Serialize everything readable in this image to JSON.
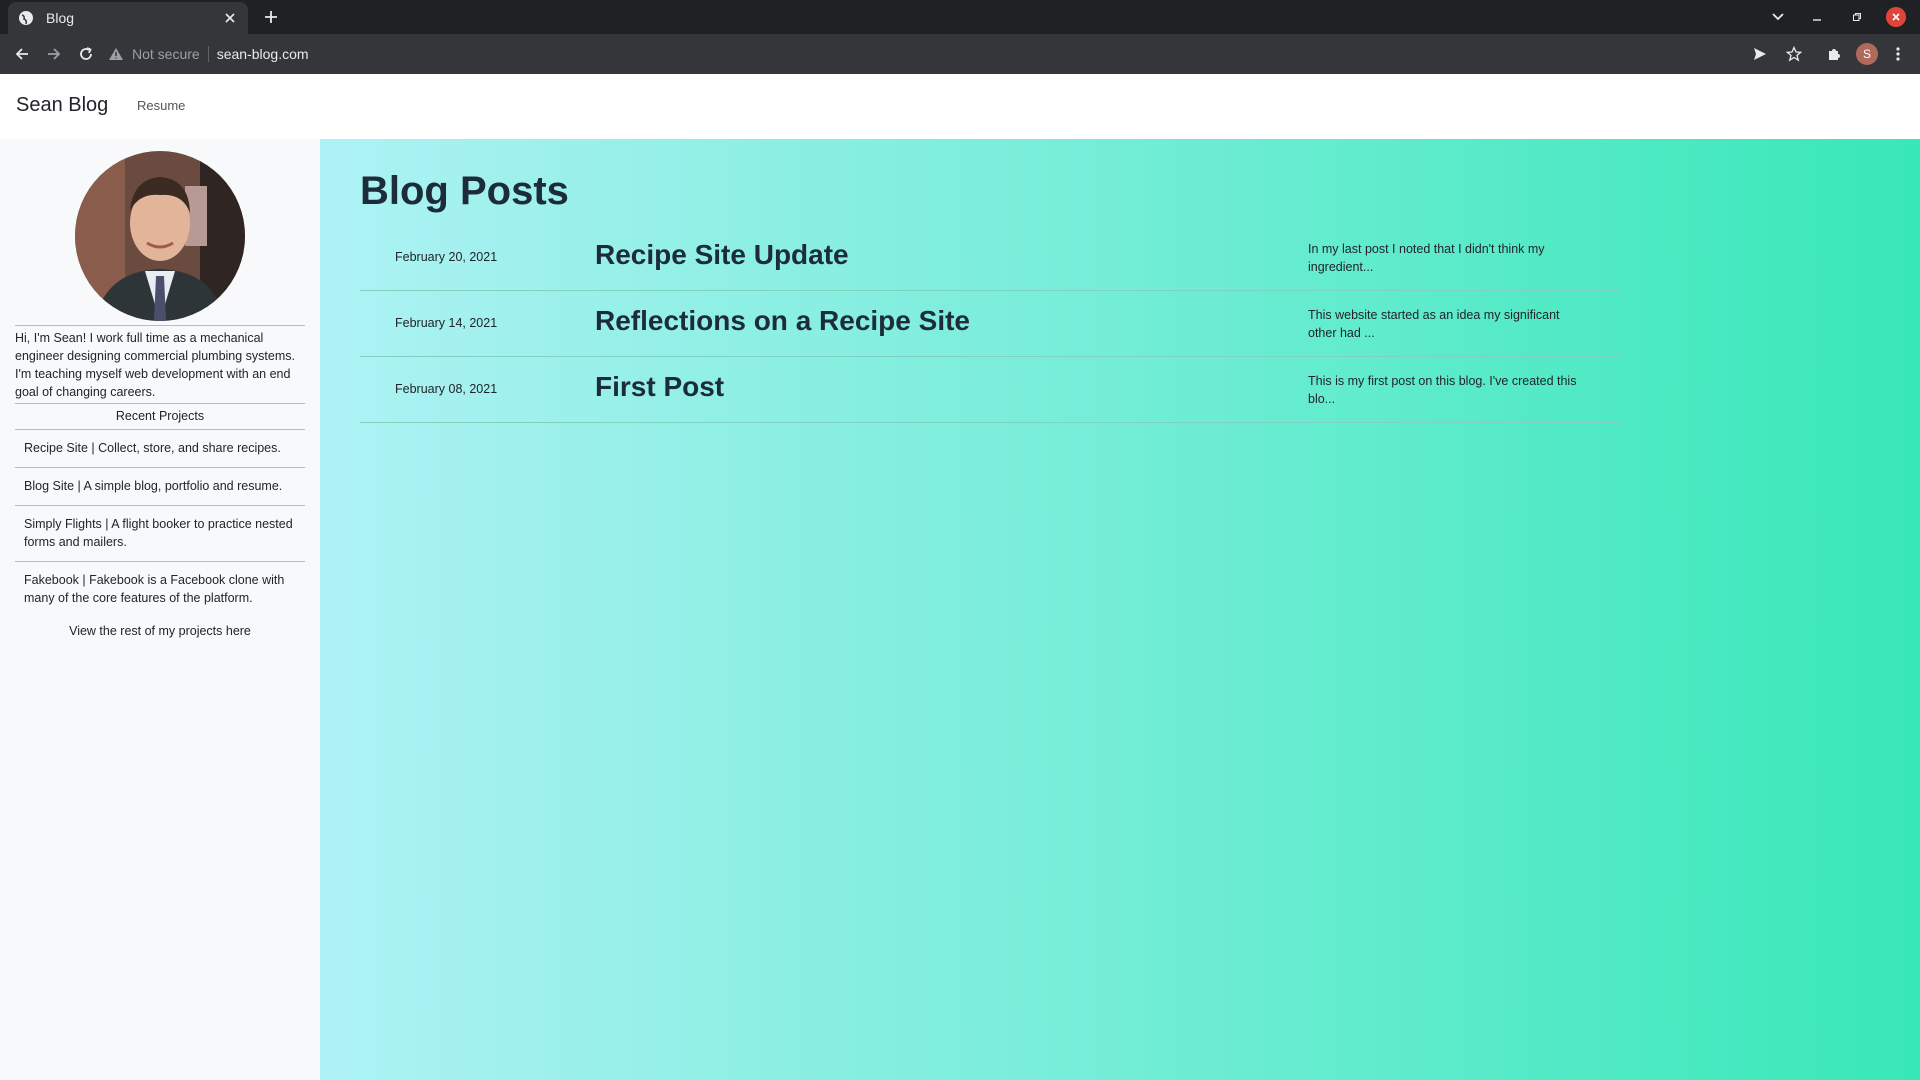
{
  "browser": {
    "tab_title": "Blog",
    "security_label": "Not secure",
    "url": "sean-blog.com",
    "profile_initial": "S"
  },
  "nav": {
    "brand": "Sean Blog",
    "resume_link": "Resume"
  },
  "sidebar": {
    "bio": "Hi, I'm Sean! I work full time as a mechanical engineer designing commercial plumbing systems. I'm teaching myself web development with an end goal of changing careers.",
    "recent_title": "Recent Projects",
    "projects": [
      {
        "text": "Recipe Site | Collect, store, and share recipes."
      },
      {
        "text": "Blog Site | A simple blog, portfolio and resume."
      },
      {
        "text": "Simply Flights | A flight booker to practice nested forms and mailers."
      },
      {
        "text": "Fakebook | Fakebook is a Facebook clone with many of the core features of the platform."
      }
    ],
    "view_rest": "View the rest of my projects here"
  },
  "main": {
    "title": "Blog Posts",
    "posts": [
      {
        "date": "February 20, 2021",
        "title": "Recipe Site Update",
        "excerpt": "In my last post I noted that I didn't think my ingredient..."
      },
      {
        "date": "February 14, 2021",
        "title": "Reflections on a Recipe Site",
        "excerpt": "This website started as an idea my significant other had ..."
      },
      {
        "date": "February 08, 2021",
        "title": "First Post",
        "excerpt": "This is my first post on this blog. I've created this blo..."
      }
    ]
  },
  "colors": {
    "gradient_start": "#aef2f5",
    "gradient_end": "#38e8b8",
    "divider": "#7fd8c0"
  }
}
